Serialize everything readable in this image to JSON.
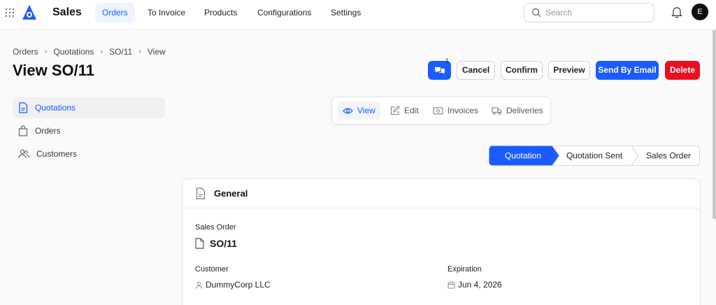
{
  "app": {
    "title": "Sales",
    "avatar_initial": "E"
  },
  "nav": {
    "items": [
      "Orders",
      "To Invoice",
      "Products",
      "Configurations",
      "Settings"
    ],
    "active": "Orders"
  },
  "search": {
    "placeholder": "Search",
    "value": ""
  },
  "breadcrumb": [
    "Orders",
    "Quotations",
    "SO/11",
    "View"
  ],
  "page_title": "View SO/11",
  "actions": {
    "comment_badge": "1",
    "cancel": "Cancel",
    "confirm": "Confirm",
    "preview": "Preview",
    "send_email": "Send By Email",
    "delete": "Delete"
  },
  "sidebar": {
    "items": [
      {
        "label": "Quotations",
        "icon": "document-icon",
        "active": true
      },
      {
        "label": "Orders",
        "icon": "shopping-bag-icon",
        "active": false
      },
      {
        "label": "Customers",
        "icon": "users-icon",
        "active": false
      }
    ]
  },
  "tabs": [
    {
      "label": "View",
      "icon": "eye-icon",
      "active": true
    },
    {
      "label": "Edit",
      "icon": "edit-icon",
      "active": false
    },
    {
      "label": "Invoices",
      "icon": "money-icon",
      "active": false
    },
    {
      "label": "Deliveries",
      "icon": "truck-icon",
      "active": false
    }
  ],
  "stepper": {
    "steps": [
      "Quotation",
      "Quotation Sent",
      "Sales Order"
    ],
    "current": "Quotation"
  },
  "card": {
    "title": "General",
    "sales_order_label": "Sales Order",
    "sales_order_value": "SO/11",
    "customer_label": "Customer",
    "customer_value": "DummyCorp LLC",
    "expiration_label": "Expiration",
    "expiration_value": "Jun 4, 2026"
  },
  "colors": {
    "accent": "#1a5cff",
    "danger": "#e8101e"
  }
}
